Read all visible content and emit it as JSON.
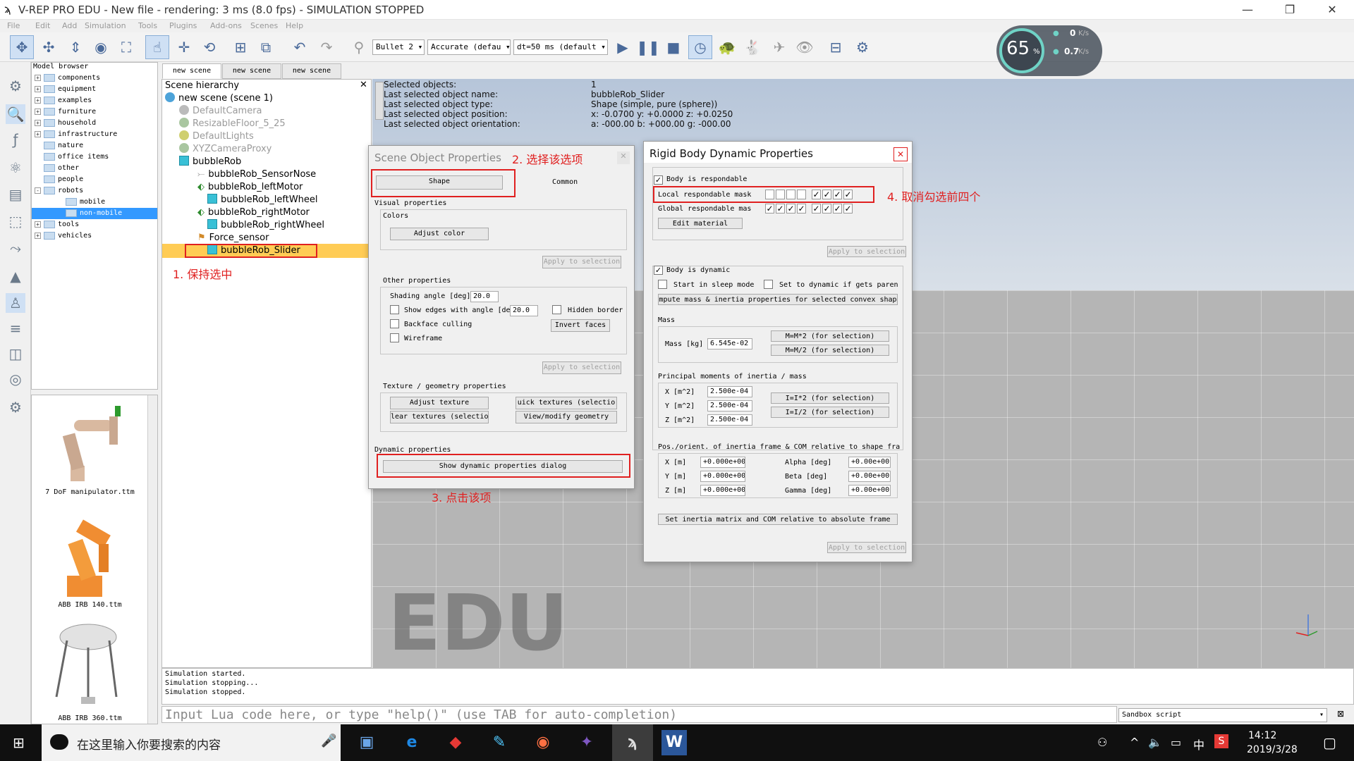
{
  "window": {
    "title": "V-REP PRO EDU - New file - rendering: 3 ms (8.0 fps) - SIMULATION STOPPED",
    "min_glyph": "—",
    "max_glyph": "❐",
    "close_glyph": "✕"
  },
  "menu": [
    "File",
    "Edit",
    "Add",
    "Simulation",
    "Tools",
    "Plugins",
    "Add-ons",
    "Scenes",
    "Help"
  ],
  "toolbar": {
    "engine": "Bullet 2",
    "accuracy": "Accurate (defau",
    "timestep": "dt=50 ms (default"
  },
  "perf": {
    "cpu": "65",
    "cpu_unit": "%",
    "up": "0",
    "up_unit": "K/s",
    "down": "0.7",
    "down_unit": "K/s"
  },
  "model_browser": {
    "title": "Model browser",
    "items": [
      {
        "label": "components",
        "expand": "+"
      },
      {
        "label": "equipment",
        "expand": "+"
      },
      {
        "label": "examples",
        "expand": "+"
      },
      {
        "label": "furniture",
        "expand": "+"
      },
      {
        "label": "household",
        "expand": "+"
      },
      {
        "label": "infrastructure",
        "expand": "+"
      },
      {
        "label": "nature",
        "expand": ""
      },
      {
        "label": "office items",
        "expand": ""
      },
      {
        "label": "other",
        "expand": ""
      },
      {
        "label": "people",
        "expand": ""
      },
      {
        "label": "robots",
        "expand": "-"
      },
      {
        "label": "mobile",
        "expand": ""
      },
      {
        "label": "non-mobile",
        "expand": ""
      },
      {
        "label": "tools",
        "expand": "+"
      },
      {
        "label": "vehicles",
        "expand": "+"
      }
    ],
    "thumbs": [
      "7 DoF manipulator.ttm",
      "ABB IRB 140.ttm",
      "ABB IRB 360.ttm"
    ]
  },
  "scene_tabs": [
    "new scene",
    "new scene",
    "new scene"
  ],
  "hierarchy": {
    "title": "Scene hierarchy",
    "items": [
      "new scene (scene 1)",
      "DefaultCamera",
      "ResizableFloor_5_25",
      "DefaultLights",
      "XYZCameraProxy",
      "bubbleRob",
      "bubbleRob_SensorNose",
      "bubbleRob_leftMotor",
      "bubbleRob_leftWheel",
      "bubbleRob_rightMotor",
      "bubbleRob_rightWheel",
      "Force_sensor",
      "bubbleRob_Slider"
    ]
  },
  "selection_info": {
    "rows": [
      {
        "label": "Selected objects:",
        "value": "1"
      },
      {
        "label": "Last selected object name:",
        "value": "bubbleRob_Slider"
      },
      {
        "label": "Last selected object type:",
        "value": "Shape (simple, pure (sphere))"
      },
      {
        "label": "Last selected object position:",
        "value": "x: -0.0700    y: +0.0000    z: +0.0250"
      },
      {
        "label": "Last selected object orientation:",
        "value": "a: -000.00    b: +000.00    g: -000.00"
      }
    ]
  },
  "scene_props": {
    "title": "Scene Object Properties",
    "tab_shape": "Shape",
    "tab_common": "Common",
    "visual": "Visual properties",
    "colors": "Colors",
    "adjust_color": "Adjust color",
    "apply": "Apply to selection",
    "other": "Other properties",
    "shading_label": "Shading angle [deg]",
    "shading_value": "20.0",
    "show_edges": "Show edges with angle [de",
    "edges_value": "20.0",
    "hidden_border": "Hidden border",
    "backface": "Backface culling",
    "invert_faces": "Invert faces",
    "wireframe": "Wireframe",
    "texture": "Texture / geometry properties",
    "adjust_texture": "Adjust texture",
    "quick_textures": "uick textures (selectio",
    "clear_textures": "lear textures (selectio",
    "view_geometry": "View/modify geometry",
    "dynamic": "Dynamic properties",
    "show_dynamic": "Show dynamic properties dialog"
  },
  "rigid_props": {
    "title": "Rigid Body Dynamic Properties",
    "close_glyph": "✕",
    "respondable": "Body is respondable",
    "local_mask": "Local respondable mask",
    "local_mask_values": [
      false,
      false,
      false,
      false,
      true,
      true,
      true,
      true
    ],
    "global_mask": "Global respondable mas",
    "global_mask_values": [
      true,
      true,
      true,
      true,
      true,
      true,
      true,
      true
    ],
    "edit_material": "Edit material",
    "apply": "Apply to selection",
    "dynamic": "Body is dynamic",
    "sleep": "Start in sleep mode",
    "set_dynamic": "Set to dynamic if gets paren",
    "compute_mass": "mpute mass & inertia properties for selected convex shap",
    "mass_title": "Mass",
    "mass_label": "Mass [kg]",
    "mass_value": "6.545e-02",
    "mass_x2": "M=M*2  (for selection)",
    "mass_div2": "M=M/2  (for selection)",
    "inertia_title": "Principal moments of inertia / mass",
    "inertia": [
      {
        "axis": "X [m^2]",
        "value": "2.500e-04"
      },
      {
        "axis": "Y [m^2]",
        "value": "2.500e-04"
      },
      {
        "axis": "Z [m^2]",
        "value": "2.500e-04"
      }
    ],
    "inertia_x2": "I=I*2  (for selection)",
    "inertia_div2": "I=I/2  (for selection)",
    "pos_title": "Pos./orient. of inertia frame & COM relative to shape fra",
    "pos": [
      {
        "axis": "X [m]",
        "value": "+0.000e+00",
        "rot": "Alpha [deg]",
        "rot_value": "+0.00e+00"
      },
      {
        "axis": "Y [m]",
        "value": "+0.000e+00",
        "rot": "Beta [deg]",
        "rot_value": "+0.00e+00"
      },
      {
        "axis": "Z [m]",
        "value": "+0.000e+00",
        "rot": "Gamma [deg]",
        "rot_value": "+0.00e+00"
      }
    ],
    "set_inertia": "Set inertia matrix and COM relative to absolute frame"
  },
  "annotations": {
    "a1": "1. 保持选中",
    "a2": "2. 选择该选项",
    "a3": "3. 点击该项",
    "a4": "4. 取消勾选前四个"
  },
  "watermark": "EDU",
  "console": [
    "Simulation started.",
    "Simulation stopping...",
    "Simulation stopped."
  ],
  "command": {
    "placeholder": "Input Lua code here, or type \"help()\" (use TAB for auto-completion)",
    "script": "Sandbox script"
  },
  "taskbar": {
    "search": "在这里输入你要搜索的内容",
    "ime": "中",
    "time": "14:12",
    "date": "2019/3/28"
  }
}
